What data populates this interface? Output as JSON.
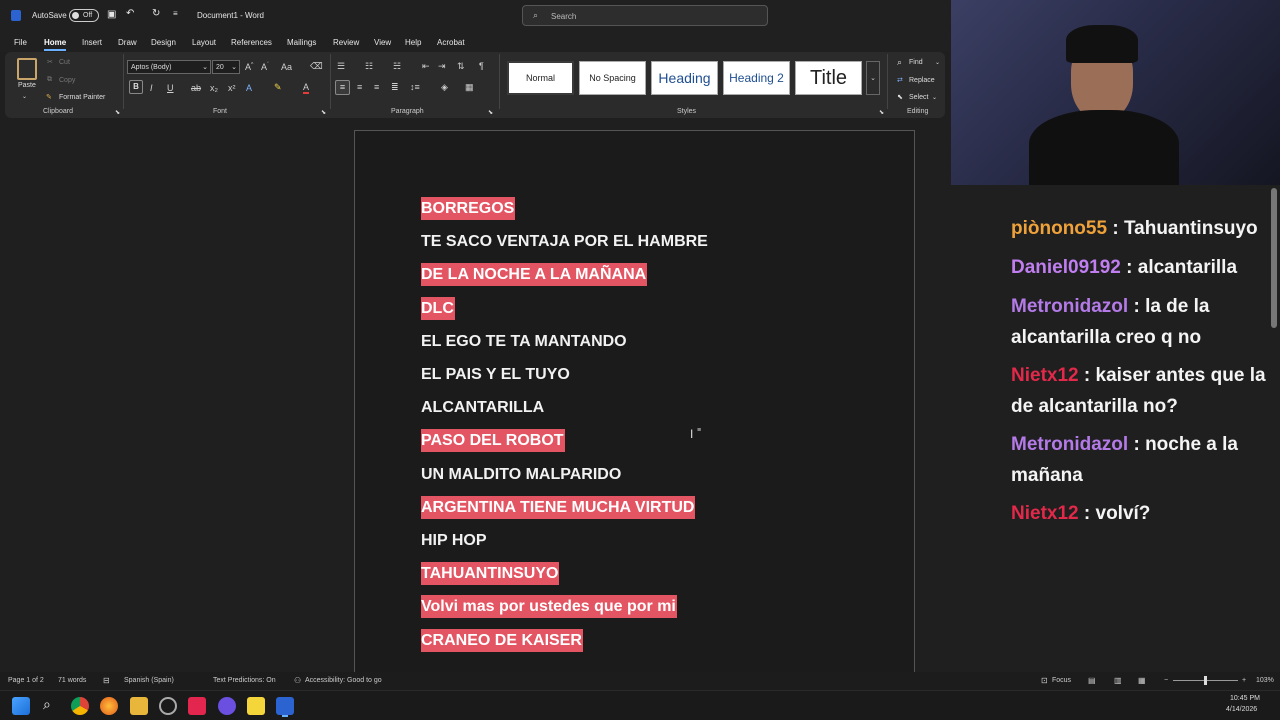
{
  "titlebar": {
    "autosave_label": "AutoSave",
    "autosave_state": "Off",
    "doc_title": "Document1 - Word",
    "search_placeholder": "Search"
  },
  "menu": {
    "file": "File",
    "home": "Home",
    "insert": "Insert",
    "draw": "Draw",
    "design": "Design",
    "layout": "Layout",
    "references": "References",
    "mailings": "Mailings",
    "review": "Review",
    "view": "View",
    "help": "Help",
    "acrobat": "Acrobat"
  },
  "ribbon": {
    "paste": "Paste",
    "cut": "Cut",
    "copy": "Copy",
    "format_painter": "Format Painter",
    "clipboard": "Clipboard",
    "font_name": "Aptos (Body)",
    "font_size": "20",
    "font": "Font",
    "paragraph": "Paragraph",
    "styles": {
      "normal": "Normal",
      "no_spacing": "No Spacing",
      "heading1": "Heading",
      "heading2": "Heading 2",
      "title": "Title",
      "label": "Styles"
    },
    "find": "Find",
    "replace": "Replace",
    "select": "Select",
    "editing": "Editing"
  },
  "document": {
    "lines": [
      {
        "text": "BORREGOS",
        "highlight": true
      },
      {
        "text": "TE SACO VENTAJA POR EL HAMBRE",
        "highlight": false
      },
      {
        "text": "DE LA NOCHE A LA MAÑANA",
        "highlight": true
      },
      {
        "text": "DLC",
        "highlight": true
      },
      {
        "text": "EL EGO TE TA MANTANDO",
        "highlight": false
      },
      {
        "text": "EL PAIS Y EL TUYO",
        "highlight": false
      },
      {
        "text": "ALCANTARILLA",
        "highlight": false
      },
      {
        "text": "PASO DEL ROBOT",
        "highlight": true
      },
      {
        "text": "UN MALDITO MALPARIDO",
        "highlight": false
      },
      {
        "text": "ARGENTINA TIENE MUCHA VIRTUD",
        "highlight": true
      },
      {
        "text": "HIP HOP",
        "highlight": false
      },
      {
        "text": "TAHUANTINSUYO",
        "highlight": true
      },
      {
        "text": "Volvi mas por ustedes que por mi",
        "highlight": true
      },
      {
        "text": "CRANEO DE KAISER",
        "highlight": true
      }
    ],
    "highlight_color": "#e45563"
  },
  "chat": {
    "messages": [
      {
        "user": "piònono55",
        "color": "#f0a23a",
        "text": "Tahuantinsuyo"
      },
      {
        "user": "Daniel09192",
        "color": "#c07ef0",
        "text": "alcantarilla"
      },
      {
        "user": "Metronidazol",
        "color": "#b37ae8",
        "text": "la de la alcantarilla creo q no"
      },
      {
        "user": "Nietx12",
        "color": "#e2294a",
        "text": "kaiser antes que la de alcantarilla no?"
      },
      {
        "user": "Metronidazol",
        "color": "#b37ae8",
        "text": "noche a la mañana"
      },
      {
        "user": "Nietx12",
        "color": "#e2294a",
        "text": "volví?"
      }
    ]
  },
  "statusbar": {
    "page": "Page 1 of 2",
    "words": "71 words",
    "language": "Spanish (Spain)",
    "predictions": "Text Predictions: On",
    "accessibility": "Accessibility: Good to go",
    "focus": "Focus",
    "zoom": "103%"
  },
  "taskbar": {
    "time": "10:45 PM",
    "date": "4/14/2026"
  }
}
